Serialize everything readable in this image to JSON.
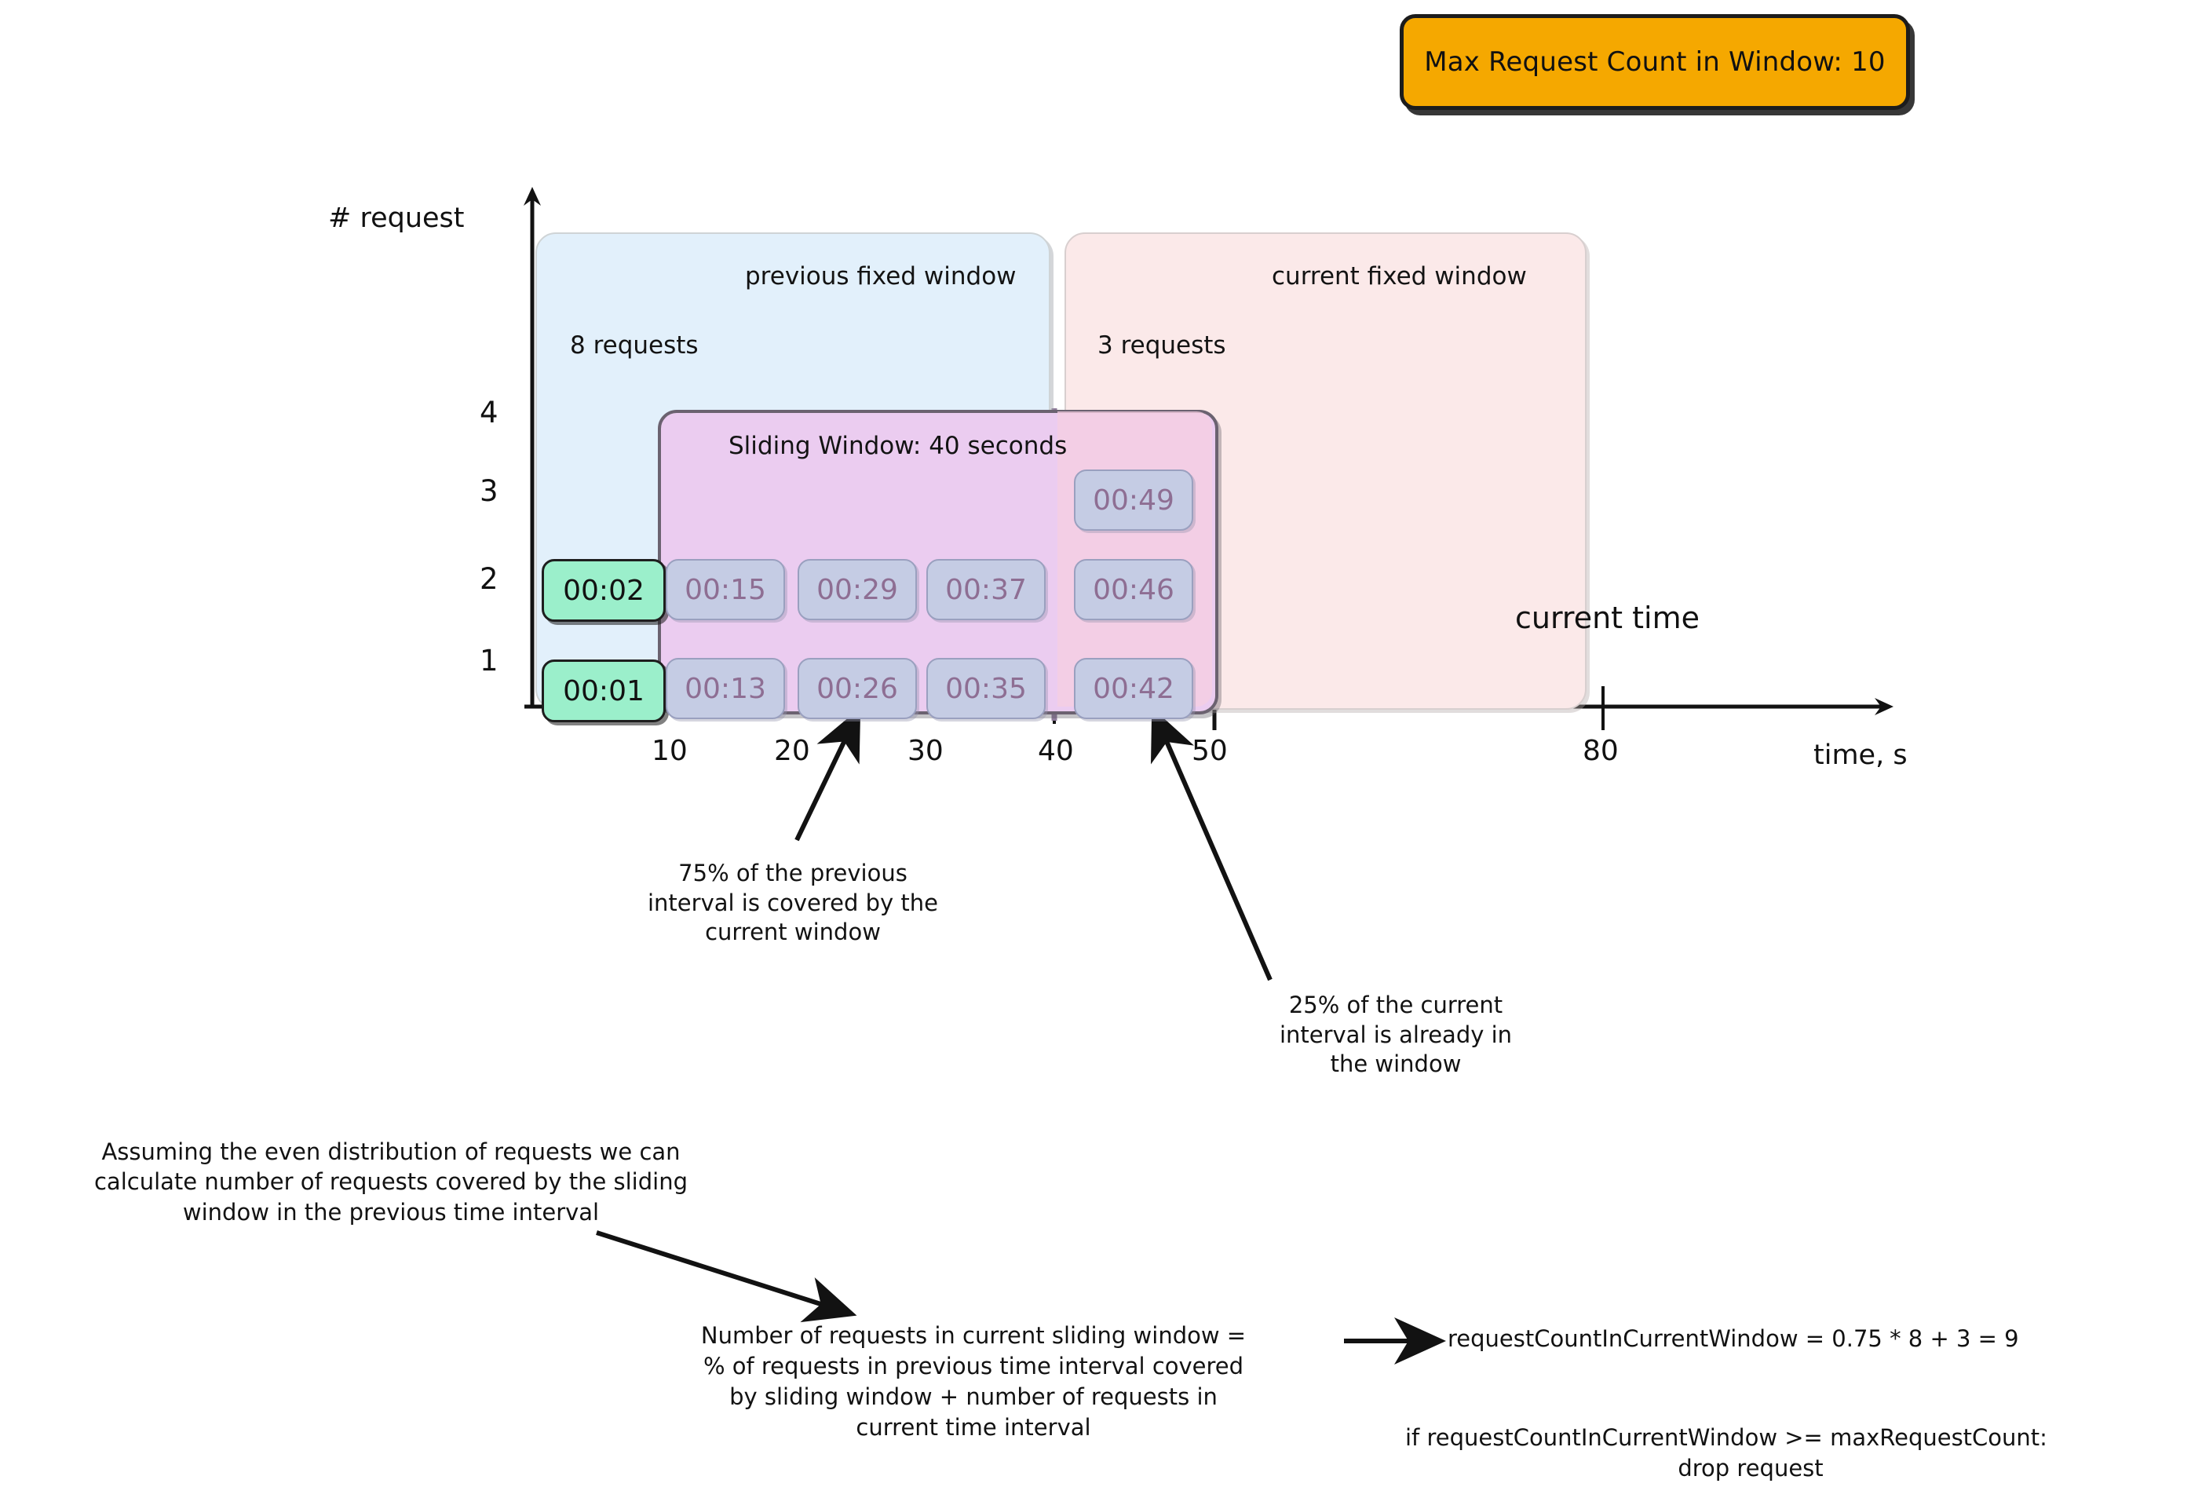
{
  "badge": {
    "label": "Max Request Count in Window: 10"
  },
  "axes": {
    "y_title": "# request",
    "x_title": "time, s",
    "y_ticks": [
      "4",
      "3",
      "2",
      "1"
    ],
    "x_ticks": [
      "10",
      "20",
      "30",
      "40",
      "50",
      "80"
    ]
  },
  "windows": {
    "previous": {
      "title": "previous fixed window",
      "count_label": "8 requests"
    },
    "current": {
      "title": "current fixed window",
      "count_label": "3 requests"
    },
    "sliding": {
      "title": "Sliding Window: 40 seconds"
    }
  },
  "requests": {
    "previous_outside": [
      "00:02",
      "00:01"
    ],
    "sliding_previous": [
      "00:15",
      "00:29",
      "00:37",
      "00:13",
      "00:26",
      "00:35"
    ],
    "sliding_current": [
      "00:49",
      "00:46",
      "00:42"
    ]
  },
  "labels": {
    "current_time": "current time"
  },
  "annotations": {
    "coverage_prev": [
      "75% of the previous",
      "interval is covered by the",
      "current window"
    ],
    "coverage_curr": [
      "25% of the current",
      "interval is already in",
      "the window"
    ],
    "assumption": [
      "Assuming the even distribution of requests we can",
      "calculate number of requests covered by the sliding",
      "window in the previous time interval"
    ],
    "formula_words": [
      "Number of requests in current sliding window =",
      "% of requests in previous time interval covered",
      "by sliding window + number of requests in",
      "current time interval"
    ],
    "formula_code": "requestCountInCurrentWindow = 0.75 * 8 + 3 = 9",
    "condition_code": [
      "if requestCountInCurrentWindow >= maxRequestCount:",
      "drop request"
    ]
  },
  "chart_data": {
    "type": "table",
    "title": "Sliding Window Rate Limiter",
    "xlabel": "time, s",
    "ylabel": "# request",
    "xlim": [
      0,
      95
    ],
    "ylim": [
      0,
      5
    ],
    "x_ticks": [
      10,
      20,
      30,
      40,
      50,
      80
    ],
    "y_ticks": [
      1,
      2,
      3,
      4
    ],
    "grid": false,
    "legend": "none",
    "regions": [
      {
        "name": "previous fixed window",
        "x_start": 0,
        "x_end": 40,
        "color": "#E2F0FB",
        "request_count": 8
      },
      {
        "name": "current fixed window",
        "x_start": 40,
        "x_end": 80,
        "color": "#FBE9E9",
        "request_count": 3
      },
      {
        "name": "Sliding Window: 40 seconds",
        "x_start": 10,
        "x_end": 50,
        "color": "#EBCCF0",
        "duration_seconds": 40
      }
    ],
    "requests": [
      {
        "time": "00:01",
        "t": 1,
        "stack": 1,
        "in_sliding_window": false
      },
      {
        "time": "00:02",
        "t": 2,
        "stack": 2,
        "in_sliding_window": false
      },
      {
        "time": "00:13",
        "t": 13,
        "stack": 1,
        "in_sliding_window": true
      },
      {
        "time": "00:15",
        "t": 15,
        "stack": 2,
        "in_sliding_window": true
      },
      {
        "time": "00:26",
        "t": 26,
        "stack": 1,
        "in_sliding_window": true
      },
      {
        "time": "00:29",
        "t": 29,
        "stack": 2,
        "in_sliding_window": true
      },
      {
        "time": "00:35",
        "t": 35,
        "stack": 1,
        "in_sliding_window": true
      },
      {
        "time": "00:37",
        "t": 37,
        "stack": 2,
        "in_sliding_window": true
      },
      {
        "time": "00:42",
        "t": 42,
        "stack": 1,
        "in_sliding_window": true
      },
      {
        "time": "00:46",
        "t": 46,
        "stack": 2,
        "in_sliding_window": true
      },
      {
        "time": "00:49",
        "t": 49,
        "stack": 3,
        "in_sliding_window": true
      }
    ],
    "markers": [
      {
        "name": "current time",
        "t": 50
      },
      {
        "name": "fixed window boundary (dashed)",
        "t": 40
      }
    ],
    "computation": {
      "prev_interval_coverage_pct": 75,
      "curr_interval_coverage_pct": 25,
      "prev_window_requests": 8,
      "curr_window_requests": 3,
      "requestCountInCurrentWindow": 9,
      "maxRequestCount": 10
    }
  }
}
